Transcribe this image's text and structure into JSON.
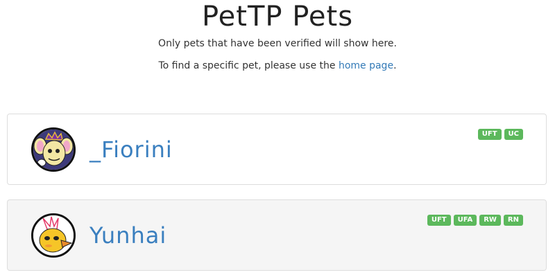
{
  "header": {
    "title": "PetTP Pets",
    "line1": "Only pets that have been verified will show here.",
    "line2_prefix": "To find a specific pet, please use the ",
    "line2_link": "home page",
    "line2_suffix": "."
  },
  "pets": [
    {
      "name": "_Fiorini",
      "badges": [
        "UFT",
        "UC"
      ]
    },
    {
      "name": "Yunhai",
      "badges": [
        "UFT",
        "UFA",
        "RW",
        "RN"
      ]
    }
  ],
  "colors": {
    "link": "#337ab7",
    "badge": "#5cb85c",
    "name": "#3a7fbf"
  }
}
